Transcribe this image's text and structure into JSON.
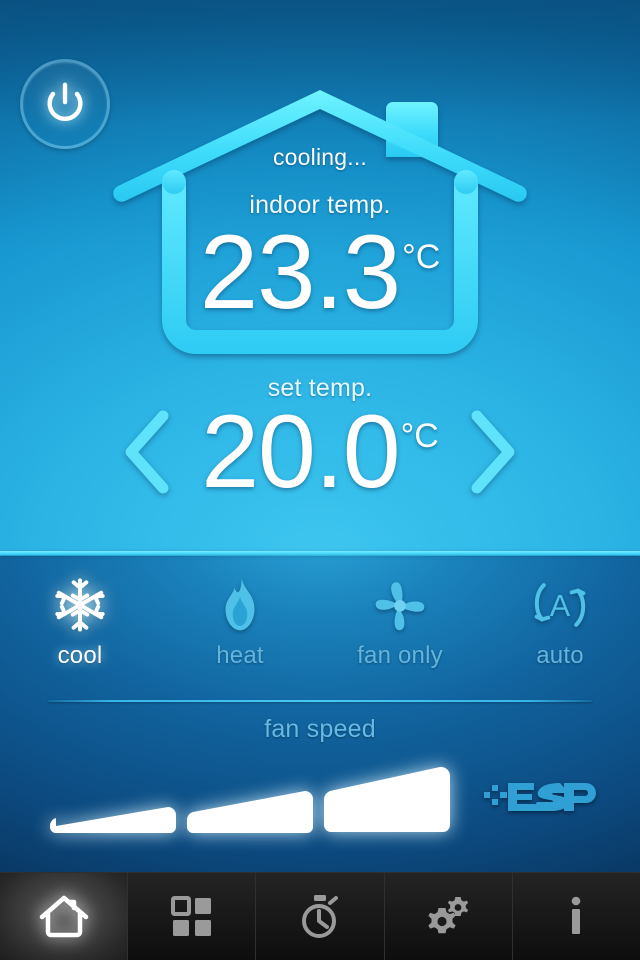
{
  "app": {
    "accent_cyan": "#4fe3ff",
    "bg_top": "#0a5c93",
    "bg_center": "#2bb3e4",
    "bg_bottom": "#07284a",
    "nav_bg": "#141414"
  },
  "power": {
    "label": "power-button",
    "icon": "power-icon"
  },
  "house": {
    "status": "cooling...",
    "indoor_label": "indoor temp.",
    "indoor_value": "23.3",
    "indoor_unit": "°C"
  },
  "set_temp": {
    "caption": "set temp.",
    "value": "20.0",
    "unit": "°C",
    "decrease_icon": "chevron-left-icon",
    "increase_icon": "chevron-right-icon"
  },
  "modes": {
    "items": [
      {
        "id": "cool",
        "label": "cool",
        "icon": "snowflake-icon",
        "active": true
      },
      {
        "id": "heat",
        "label": "heat",
        "icon": "flame-icon",
        "active": false
      },
      {
        "id": "fan_only",
        "label": "fan only",
        "icon": "fan-icon",
        "active": false
      },
      {
        "id": "auto",
        "label": "auto",
        "icon": "auto-icon",
        "active": false
      }
    ]
  },
  "fan_speed": {
    "title": "fan speed",
    "levels": 3,
    "selected": 3,
    "bars": [
      {
        "id": "low",
        "active": true
      },
      {
        "id": "medium",
        "active": true
      },
      {
        "id": "high",
        "active": true
      }
    ]
  },
  "brand": {
    "name": "ESP",
    "icon": "esp-logo"
  },
  "nav": {
    "items": [
      {
        "id": "home",
        "icon": "home-icon",
        "active": true
      },
      {
        "id": "zones",
        "icon": "grid-icon",
        "active": false
      },
      {
        "id": "timer",
        "icon": "stopwatch-icon",
        "active": false
      },
      {
        "id": "settings",
        "icon": "gears-icon",
        "active": false
      },
      {
        "id": "info",
        "icon": "info-icon",
        "active": false
      }
    ]
  }
}
